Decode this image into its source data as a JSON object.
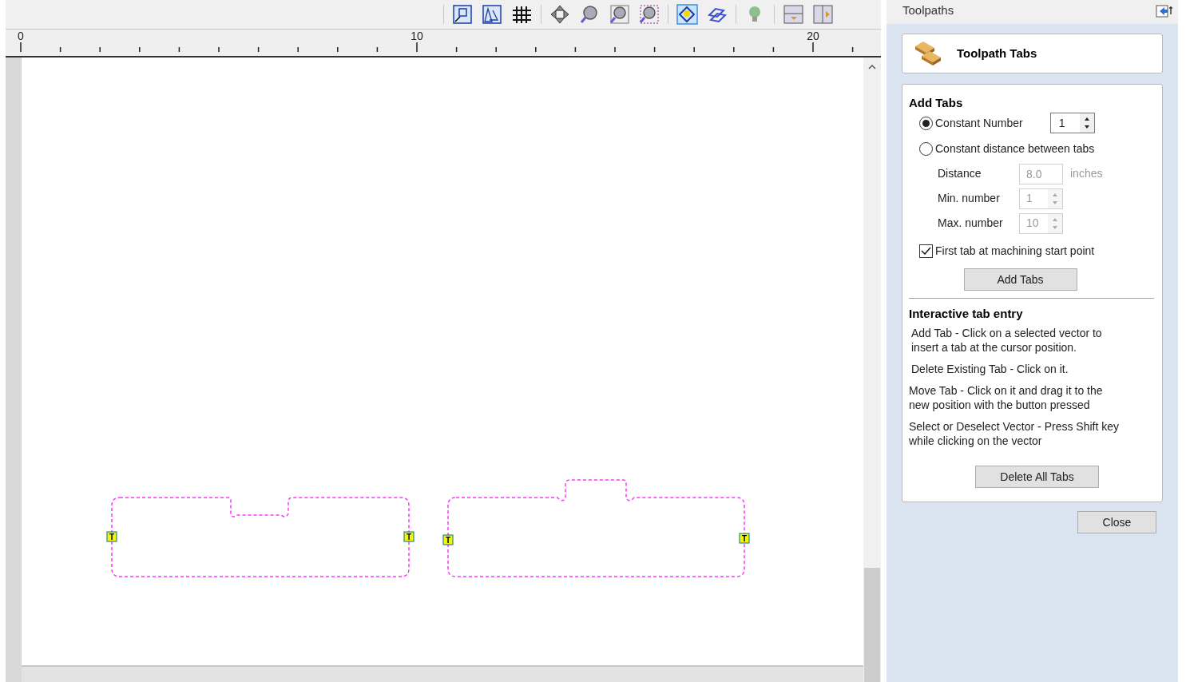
{
  "ruler": {
    "labels": [
      "0",
      "10",
      "20"
    ]
  },
  "canvas": {
    "shapes": [
      {
        "kind": "notch",
        "tabs": [
          "T",
          "T"
        ]
      },
      {
        "kind": "bump",
        "tabs": [
          "T",
          "T"
        ]
      }
    ]
  },
  "panel": {
    "title": "Toolpaths",
    "header": "Toolpath Tabs",
    "add_tabs": {
      "heading": "Add Tabs",
      "modes": [
        {
          "label": "Constant Number",
          "selected": true
        },
        {
          "label": "Constant distance between tabs",
          "selected": false
        }
      ],
      "constant_number": "1",
      "fields": [
        {
          "kind": "text",
          "label": "Distance",
          "value": "8.0",
          "unit": "inches",
          "disabled": true
        },
        {
          "kind": "spin",
          "label": "Min. number",
          "value": "1",
          "disabled": true
        },
        {
          "kind": "spin",
          "label": "Max. number",
          "value": "10",
          "disabled": true
        }
      ],
      "first_tab": {
        "label": "First tab at machining start point",
        "checked": true
      },
      "button": "Add Tabs"
    },
    "interactive": {
      "heading": "Interactive tab entry",
      "paragraphs": [
        "Add Tab - Click on a selected vector to insert a tab at the cursor position.",
        "Delete Existing Tab - Click on it.",
        "Move Tab - Click on it and drag it to the new position with the button pressed",
        "Select or Deselect Vector - Press Shift key while clicking on the vector"
      ]
    },
    "delete_button": "Delete All Tabs",
    "close_button": "Close"
  }
}
